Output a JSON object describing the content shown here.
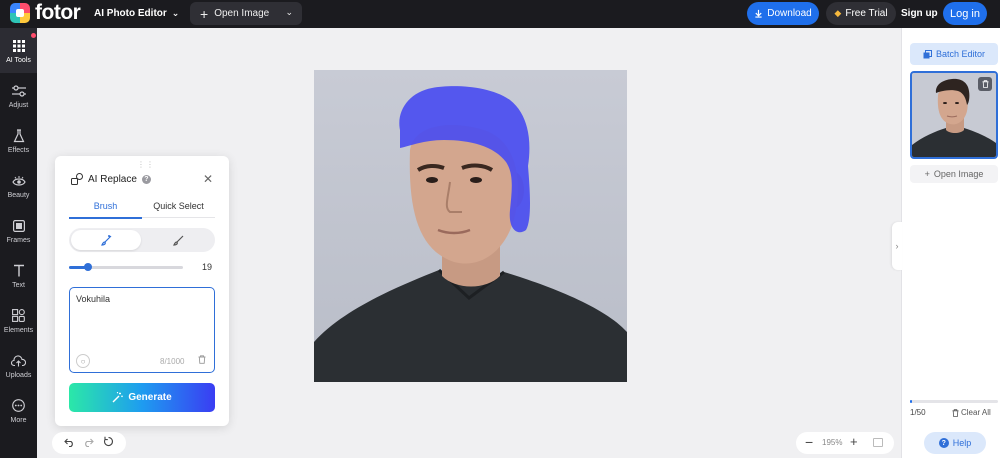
{
  "topbar": {
    "logo_text": "fotor",
    "editor_menu": "AI Photo Editor",
    "open_image": "Open Image",
    "download": "Download",
    "free_trial": "Free Trial",
    "sign_up": "Sign up",
    "log_in": "Log in"
  },
  "rail": {
    "items": [
      {
        "label": "AI Tools",
        "icon": "grid-icon"
      },
      {
        "label": "Adjust",
        "icon": "sliders-icon"
      },
      {
        "label": "Effects",
        "icon": "flask-icon"
      },
      {
        "label": "Beauty",
        "icon": "eye-icon"
      },
      {
        "label": "Frames",
        "icon": "frame-icon"
      },
      {
        "label": "Text",
        "icon": "text-icon"
      },
      {
        "label": "Elements",
        "icon": "shapes-icon"
      },
      {
        "label": "Uploads",
        "icon": "cloud-upload-icon"
      },
      {
        "label": "More",
        "icon": "more-icon"
      }
    ]
  },
  "panel": {
    "title": "AI Replace",
    "tabs": [
      "Brush",
      "Quick Select"
    ],
    "active_tab": "Brush",
    "brush_size": "19",
    "brush_size_fraction": 0.17,
    "prompt_value": "Vokuhila",
    "char_count": "8/1000",
    "generate": "Generate"
  },
  "right_panel": {
    "batch_editor": "Batch Editor",
    "open_image": "Open Image",
    "image_count": "1/50",
    "upload_fraction": 0.02,
    "clear_all": "Clear All",
    "help": "Help"
  },
  "zoom": {
    "value": "195%"
  },
  "colors": {
    "accent": "#1f6feb",
    "topbar": "#1b1b1f",
    "mask": "#4a4df0"
  }
}
